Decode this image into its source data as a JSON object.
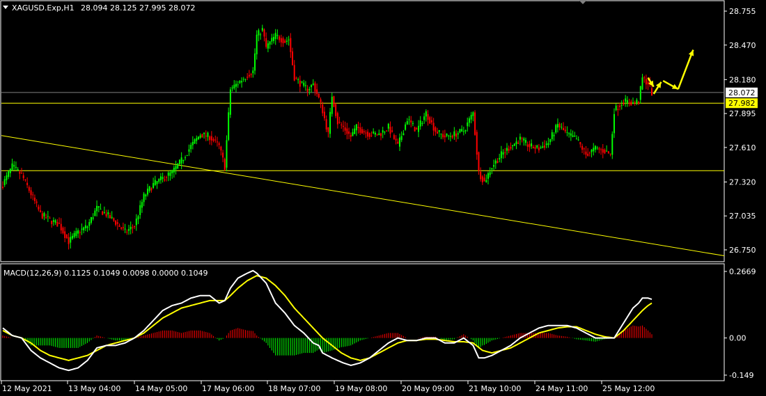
{
  "main_header": {
    "symbol": "XAGUSD.Exp,H1",
    "ohlc": "28.094 28.125 27.995 28.072"
  },
  "macd_header": "MACD(12,26,9) 0.1125 0.1049 0.0098 0.0000 0.1049",
  "colors": {
    "background": "#000000",
    "bull": "#00ff00",
    "bear": "#ff0000",
    "signal": "#ffff00",
    "macd_line": "#ffffff",
    "level_line": "#ffff00",
    "current_price_line": "#808080",
    "axis": "#ffffff"
  },
  "chart_data": [
    {
      "type": "candlestick",
      "symbol": "XAGUSD.Exp",
      "timeframe": "H1",
      "ylim": [
        26.62,
        28.86
      ],
      "y_ticks": [
        "28.755",
        "28.470",
        "28.180",
        "27.895",
        "27.610",
        "27.320",
        "27.035",
        "26.750"
      ],
      "x_ticks": [
        "12 May 2021",
        "13 May 04:00",
        "14 May 05:00",
        "17 May 06:00",
        "18 May 07:00",
        "19 May 08:00",
        "20 May 09:00",
        "21 May 10:00",
        "24 May 11:00",
        "25 May 12:00"
      ],
      "price_labels": [
        {
          "value": 28.072,
          "text": "28.072",
          "style": "current"
        },
        {
          "value": 27.982,
          "text": "27.982",
          "style": "level"
        }
      ],
      "horizontal_levels": [
        27.982,
        27.415
      ],
      "trendline": {
        "from": [
          0,
          27.71
        ],
        "to": [
          1,
          26.7
        ]
      },
      "candle_anchors": [
        [
          0,
          27.3
        ],
        [
          5,
          27.45
        ],
        [
          10,
          27.38
        ],
        [
          15,
          27.22
        ],
        [
          20,
          27.05
        ],
        [
          25,
          27.0
        ],
        [
          30,
          26.96
        ],
        [
          35,
          26.82
        ],
        [
          40,
          26.9
        ],
        [
          45,
          26.95
        ],
        [
          50,
          27.1
        ],
        [
          55,
          27.05
        ],
        [
          60,
          26.98
        ],
        [
          65,
          26.9
        ],
        [
          70,
          26.95
        ],
        [
          75,
          27.2
        ],
        [
          80,
          27.3
        ],
        [
          85,
          27.35
        ],
        [
          90,
          27.4
        ],
        [
          95,
          27.5
        ],
        [
          100,
          27.62
        ],
        [
          105,
          27.72
        ],
        [
          110,
          27.7
        ],
        [
          115,
          27.62
        ],
        [
          118,
          27.45
        ],
        [
          121,
          28.1
        ],
        [
          125,
          28.15
        ],
        [
          130,
          28.22
        ],
        [
          133,
          28.25
        ],
        [
          135,
          28.55
        ],
        [
          138,
          28.6
        ],
        [
          140,
          28.45
        ],
        [
          145,
          28.55
        ],
        [
          150,
          28.5
        ],
        [
          152,
          28.52
        ],
        [
          155,
          28.2
        ],
        [
          158,
          28.15
        ],
        [
          162,
          28.1
        ],
        [
          165,
          28.14
        ],
        [
          168,
          28.02
        ],
        [
          170,
          27.92
        ],
        [
          173,
          27.72
        ],
        [
          175,
          28.05
        ],
        [
          178,
          27.82
        ],
        [
          181,
          27.78
        ],
        [
          185,
          27.7
        ],
        [
          188,
          27.78
        ],
        [
          190,
          27.76
        ],
        [
          195,
          27.72
        ],
        [
          200,
          27.72
        ],
        [
          205,
          27.78
        ],
        [
          210,
          27.62
        ],
        [
          215,
          27.85
        ],
        [
          220,
          27.75
        ],
        [
          225,
          27.9
        ],
        [
          230,
          27.75
        ],
        [
          235,
          27.7
        ],
        [
          240,
          27.72
        ],
        [
          245,
          27.75
        ],
        [
          250,
          27.9
        ],
        [
          253,
          27.4
        ],
        [
          256,
          27.32
        ],
        [
          260,
          27.45
        ],
        [
          265,
          27.55
        ],
        [
          270,
          27.62
        ],
        [
          275,
          27.68
        ],
        [
          280,
          27.62
        ],
        [
          285,
          27.6
        ],
        [
          290,
          27.65
        ],
        [
          295,
          27.8
        ],
        [
          300,
          27.72
        ],
        [
          305,
          27.68
        ],
        [
          310,
          27.55
        ],
        [
          315,
          27.6
        ],
        [
          320,
          27.58
        ],
        [
          323,
          27.55
        ],
        [
          325,
          27.92
        ],
        [
          330,
          28.0
        ],
        [
          335,
          27.98
        ],
        [
          338,
          28.0
        ],
        [
          340,
          28.19
        ],
        [
          343,
          28.15
        ],
        [
          345,
          28.07
        ]
      ],
      "projection_arrows": [
        {
          "from": [
            343,
            28.195
          ],
          "to": [
            346,
            28.12
          ]
        },
        {
          "from": [
            346,
            28.06
          ],
          "to": [
            350,
            28.16
          ]
        },
        {
          "from": [
            351,
            28.17
          ],
          "to": [
            359,
            28.1
          ]
        },
        {
          "from": [
            359,
            28.1
          ],
          "to": [
            367,
            28.43
          ]
        }
      ]
    },
    {
      "type": "macd",
      "params": "12,26,9",
      "ylim": [
        -0.165,
        0.285
      ],
      "y_ticks": [
        "0.2669",
        "0.00",
        "-0.149"
      ],
      "macd_anchors": [
        [
          0,
          0.04
        ],
        [
          5,
          0.01
        ],
        [
          10,
          0.0
        ],
        [
          15,
          -0.05
        ],
        [
          20,
          -0.08
        ],
        [
          25,
          -0.1
        ],
        [
          30,
          -0.12
        ],
        [
          35,
          -0.13
        ],
        [
          40,
          -0.12
        ],
        [
          45,
          -0.09
        ],
        [
          50,
          -0.04
        ],
        [
          55,
          -0.03
        ],
        [
          60,
          -0.03
        ],
        [
          65,
          -0.02
        ],
        [
          70,
          0.0
        ],
        [
          75,
          0.03
        ],
        [
          80,
          0.07
        ],
        [
          85,
          0.11
        ],
        [
          90,
          0.13
        ],
        [
          95,
          0.14
        ],
        [
          100,
          0.16
        ],
        [
          105,
          0.17
        ],
        [
          110,
          0.17
        ],
        [
          115,
          0.14
        ],
        [
          118,
          0.15
        ],
        [
          121,
          0.2
        ],
        [
          125,
          0.24
        ],
        [
          130,
          0.26
        ],
        [
          133,
          0.27
        ],
        [
          135,
          0.26
        ],
        [
          140,
          0.22
        ],
        [
          145,
          0.14
        ],
        [
          150,
          0.1
        ],
        [
          155,
          0.05
        ],
        [
          160,
          0.02
        ],
        [
          165,
          -0.02
        ],
        [
          168,
          -0.03
        ],
        [
          170,
          -0.06
        ],
        [
          175,
          -0.08
        ],
        [
          178,
          -0.09
        ],
        [
          181,
          -0.1
        ],
        [
          185,
          -0.11
        ],
        [
          190,
          -0.1
        ],
        [
          195,
          -0.08
        ],
        [
          200,
          -0.05
        ],
        [
          205,
          -0.02
        ],
        [
          210,
          0.0
        ],
        [
          215,
          -0.01
        ],
        [
          220,
          -0.01
        ],
        [
          225,
          0.0
        ],
        [
          230,
          0.0
        ],
        [
          235,
          -0.02
        ],
        [
          240,
          -0.02
        ],
        [
          245,
          0.0
        ],
        [
          250,
          -0.03
        ],
        [
          253,
          -0.08
        ],
        [
          256,
          -0.08
        ],
        [
          260,
          -0.07
        ],
        [
          265,
          -0.05
        ],
        [
          270,
          -0.03
        ],
        [
          275,
          0.0
        ],
        [
          280,
          0.02
        ],
        [
          285,
          0.04
        ],
        [
          290,
          0.05
        ],
        [
          295,
          0.05
        ],
        [
          300,
          0.05
        ],
        [
          305,
          0.04
        ],
        [
          310,
          0.02
        ],
        [
          315,
          0.0
        ],
        [
          320,
          0.0
        ],
        [
          325,
          0.0
        ],
        [
          330,
          0.06
        ],
        [
          335,
          0.12
        ],
        [
          338,
          0.14
        ],
        [
          340,
          0.16
        ],
        [
          343,
          0.16
        ],
        [
          345,
          0.155
        ]
      ],
      "signal_anchors": [
        [
          0,
          0.03
        ],
        [
          5,
          0.01
        ],
        [
          10,
          0.0
        ],
        [
          15,
          -0.02
        ],
        [
          20,
          -0.05
        ],
        [
          25,
          -0.07
        ],
        [
          30,
          -0.08
        ],
        [
          35,
          -0.09
        ],
        [
          40,
          -0.08
        ],
        [
          45,
          -0.07
        ],
        [
          50,
          -0.05
        ],
        [
          55,
          -0.03
        ],
        [
          60,
          -0.02
        ],
        [
          65,
          -0.01
        ],
        [
          70,
          0.0
        ],
        [
          75,
          0.02
        ],
        [
          80,
          0.05
        ],
        [
          85,
          0.08
        ],
        [
          90,
          0.1
        ],
        [
          95,
          0.12
        ],
        [
          100,
          0.13
        ],
        [
          105,
          0.14
        ],
        [
          110,
          0.15
        ],
        [
          115,
          0.15
        ],
        [
          118,
          0.15
        ],
        [
          121,
          0.17
        ],
        [
          125,
          0.2
        ],
        [
          130,
          0.23
        ],
        [
          135,
          0.25
        ],
        [
          140,
          0.24
        ],
        [
          145,
          0.21
        ],
        [
          150,
          0.17
        ],
        [
          155,
          0.12
        ],
        [
          160,
          0.08
        ],
        [
          165,
          0.04
        ],
        [
          170,
          0.0
        ],
        [
          175,
          -0.03
        ],
        [
          180,
          -0.06
        ],
        [
          185,
          -0.08
        ],
        [
          190,
          -0.09
        ],
        [
          195,
          -0.08
        ],
        [
          200,
          -0.06
        ],
        [
          205,
          -0.04
        ],
        [
          210,
          -0.02
        ],
        [
          215,
          -0.01
        ],
        [
          220,
          -0.01
        ],
        [
          225,
          -0.005
        ],
        [
          230,
          -0.005
        ],
        [
          235,
          -0.01
        ],
        [
          240,
          -0.015
        ],
        [
          245,
          -0.015
        ],
        [
          250,
          -0.02
        ],
        [
          255,
          -0.05
        ],
        [
          260,
          -0.06
        ],
        [
          265,
          -0.05
        ],
        [
          270,
          -0.04
        ],
        [
          275,
          -0.02
        ],
        [
          280,
          0.0
        ],
        [
          285,
          0.02
        ],
        [
          290,
          0.03
        ],
        [
          295,
          0.04
        ],
        [
          300,
          0.045
        ],
        [
          305,
          0.045
        ],
        [
          310,
          0.03
        ],
        [
          315,
          0.015
        ],
        [
          320,
          0.005
        ],
        [
          325,
          0.0
        ],
        [
          330,
          0.03
        ],
        [
          335,
          0.07
        ],
        [
          340,
          0.11
        ],
        [
          343,
          0.13
        ],
        [
          345,
          0.14
        ]
      ]
    }
  ]
}
